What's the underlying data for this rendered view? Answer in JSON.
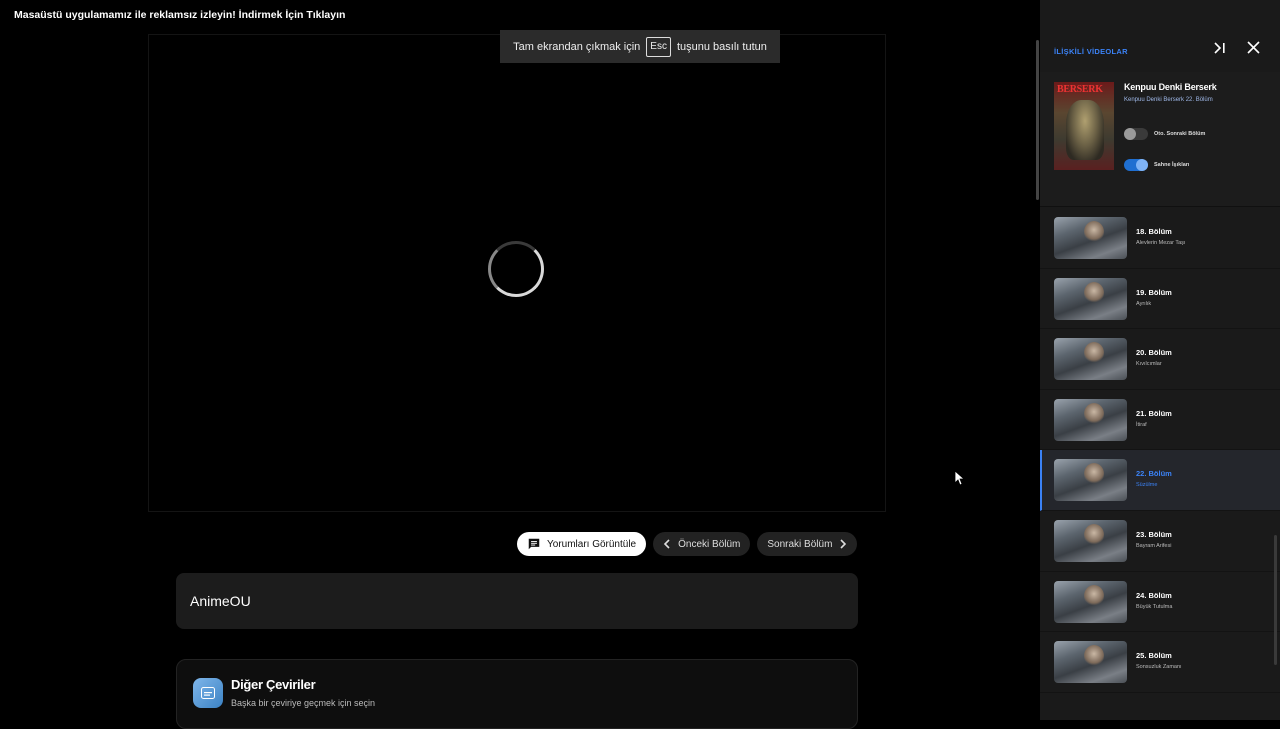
{
  "promo_banner": "Masaüstü uygulamamız ile reklamsız izleyin! İndirmek İçin Tıklayın",
  "fullscreen_toast": {
    "before": "Tam ekrandan çıkmak için",
    "key": "Esc",
    "after": "tuşunu basılı tutun"
  },
  "actions": {
    "comments": "Yorumları Görüntüle",
    "prev": "Önceki Bölüm",
    "next": "Sonraki Bölüm"
  },
  "source_card": {
    "name": "AnimeOU"
  },
  "translations_card": {
    "title": "Diğer Çeviriler",
    "subtitle": "Başka bir çeviriye geçmek için seçin"
  },
  "panel": {
    "title": "İLİŞKİLİ VİDEOLAR",
    "cover_logo": "BERSERK",
    "series_title": "Kenpuu Denki Berserk",
    "series_sub": "Kenpuu Denki Berserk 22. Bölüm",
    "toggles": [
      {
        "label": "Oto. Sonraki Bölüm",
        "on": false
      },
      {
        "label": "Sahne İşıkları",
        "on": true
      }
    ],
    "episodes": [
      {
        "num": "18. Bölüm",
        "name": "Alevlerin Mezar Taşı",
        "active": false
      },
      {
        "num": "19. Bölüm",
        "name": "Ayrılık",
        "active": false
      },
      {
        "num": "20. Bölüm",
        "name": "Kıvılcımlar",
        "active": false
      },
      {
        "num": "21. Bölüm",
        "name": "İtiraf",
        "active": false
      },
      {
        "num": "22. Bölüm",
        "name": "Süzülme",
        "active": true
      },
      {
        "num": "23. Bölüm",
        "name": "Bayram Arifesi",
        "active": false
      },
      {
        "num": "24. Bölüm",
        "name": "Büyük Tutulma",
        "active": false
      },
      {
        "num": "25. Bölüm",
        "name": "Sonsuzluk Zamanı",
        "active": false
      }
    ]
  },
  "colors": {
    "accent": "#3b82f6",
    "panel_bg": "#1a1a1a",
    "toggle_on": "#1f6fd1"
  }
}
